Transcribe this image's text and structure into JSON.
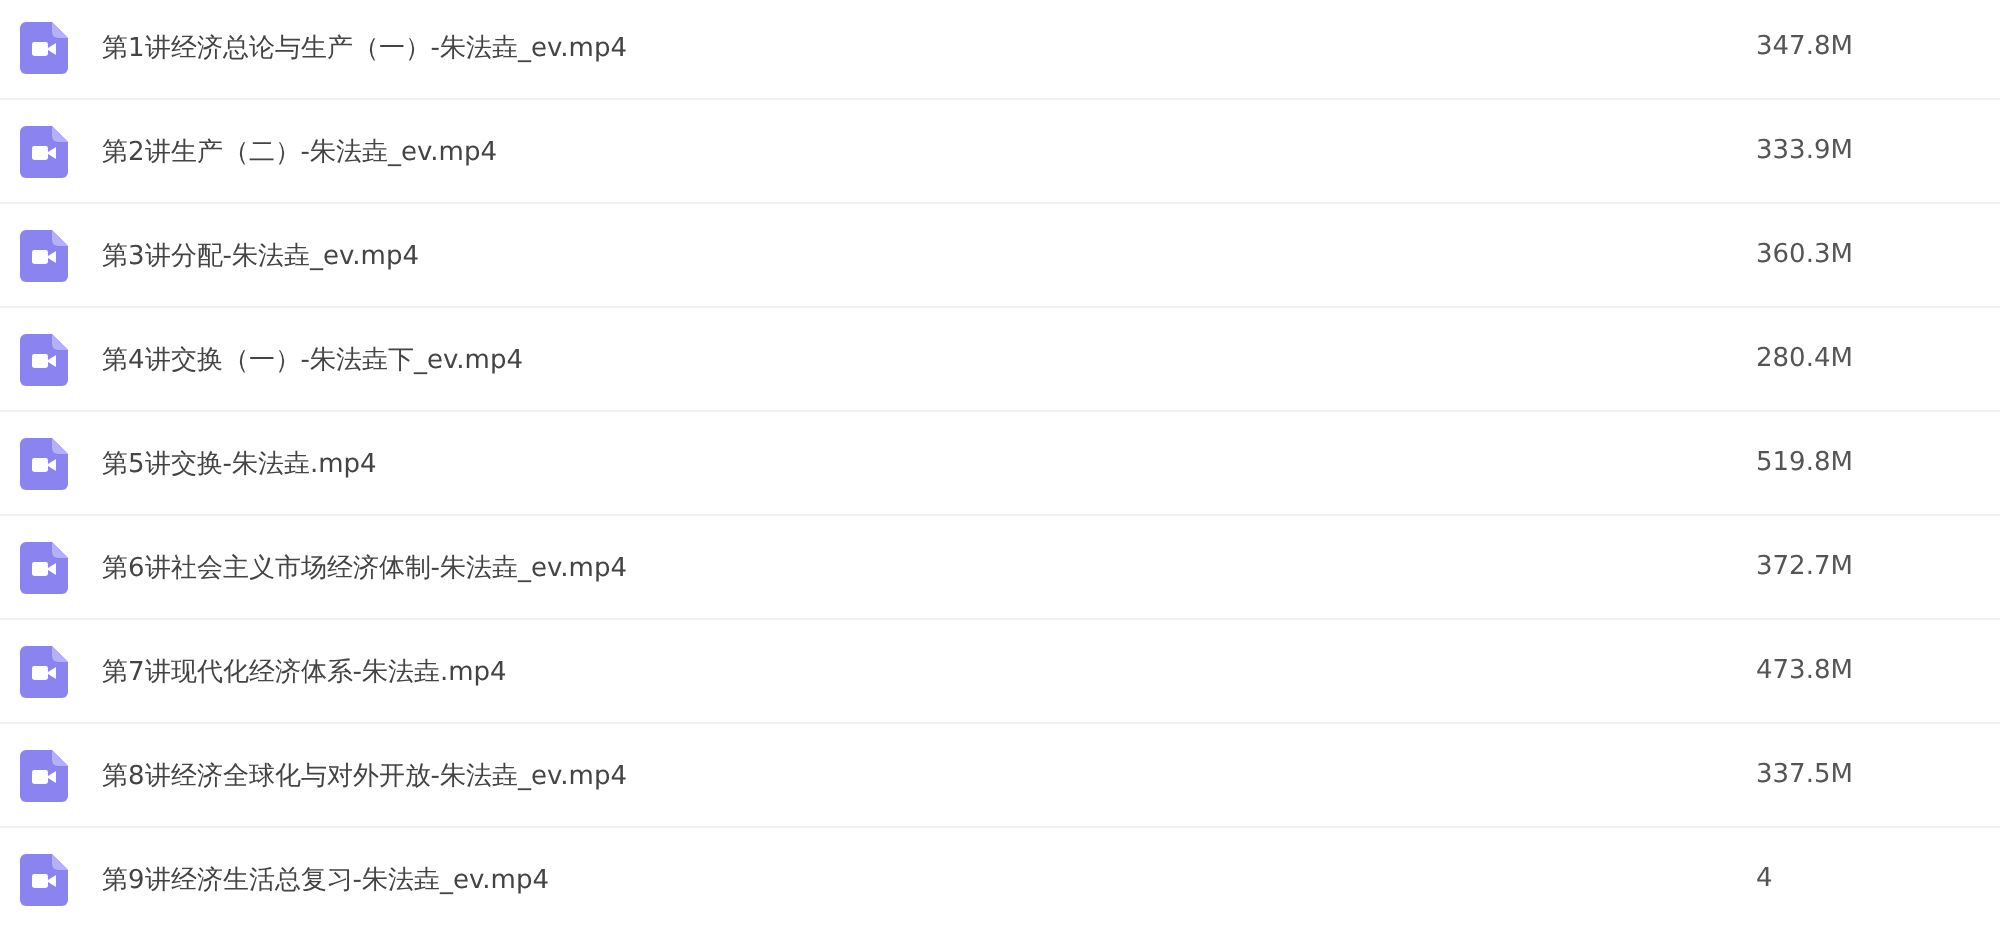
{
  "files": [
    {
      "name": "第1讲经济总论与生产（一）-朱法垚_ev.mp4",
      "size": "347.8M"
    },
    {
      "name": "第2讲生产（二）-朱法垚_ev.mp4",
      "size": "333.9M"
    },
    {
      "name": "第3讲分配-朱法垚_ev.mp4",
      "size": "360.3M"
    },
    {
      "name": "第4讲交换（一）-朱法垚下_ev.mp4",
      "size": "280.4M"
    },
    {
      "name": "第5讲交换-朱法垚.mp4",
      "size": "519.8M"
    },
    {
      "name": "第6讲社会主义市场经济体制-朱法垚_ev.mp4",
      "size": "372.7M"
    },
    {
      "name": "第7讲现代化经济体系-朱法垚.mp4",
      "size": "473.8M"
    },
    {
      "name": "第8讲经济全球化与对外开放-朱法垚_ev.mp4",
      "size": "337.5M"
    },
    {
      "name": "第9讲经济生活总复习-朱法垚_ev.mp4",
      "size": "4"
    }
  ]
}
